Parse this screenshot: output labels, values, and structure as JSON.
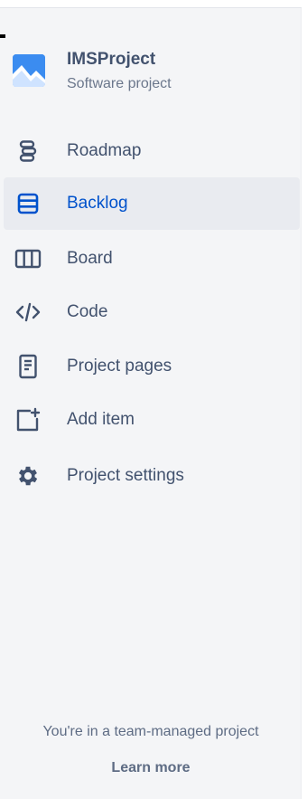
{
  "project": {
    "name": "IMSProject",
    "type": "Software project"
  },
  "nav": {
    "items": [
      {
        "label": "Roadmap",
        "icon": "roadmap-icon"
      },
      {
        "label": "Backlog",
        "icon": "backlog-icon",
        "active": true
      },
      {
        "label": "Board",
        "icon": "board-icon"
      },
      {
        "label": "Code",
        "icon": "code-icon"
      },
      {
        "label": "Project pages",
        "icon": "page-icon"
      },
      {
        "label": "Add item",
        "icon": "add-item-icon"
      },
      {
        "label": "Project settings",
        "icon": "gear-icon"
      }
    ]
  },
  "footer": {
    "message": "You're in a team-managed project",
    "link": "Learn more"
  },
  "colors": {
    "active_text": "#0052cc",
    "active_bg": "#e9ebf0",
    "text": "#42526e",
    "sidebar_bg": "#f4f5f7",
    "avatar_blue": "#3b8cf0"
  }
}
